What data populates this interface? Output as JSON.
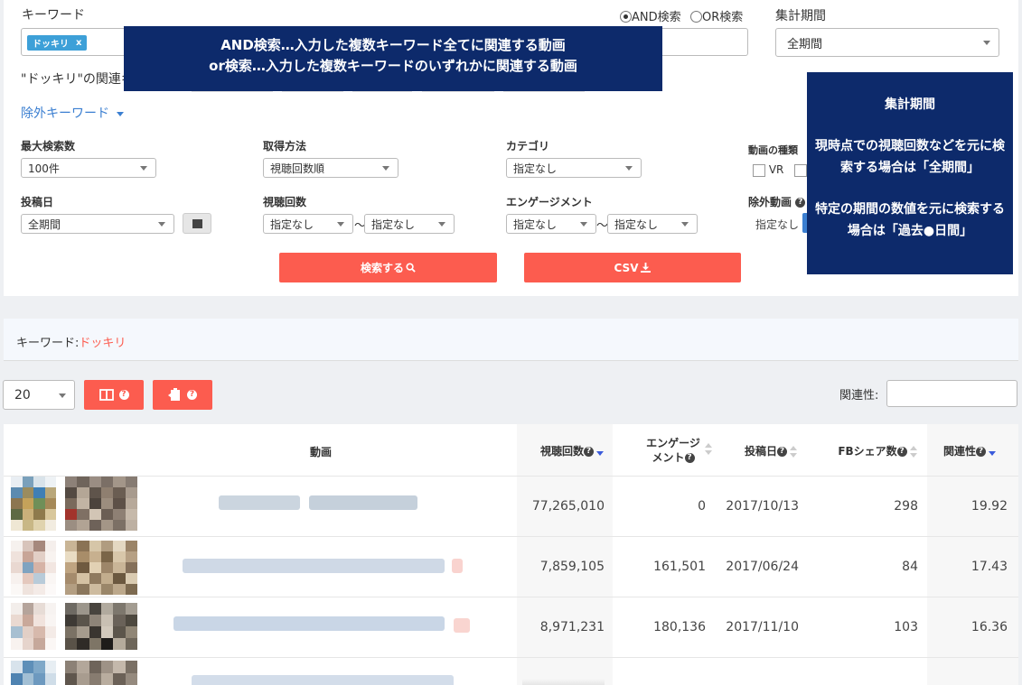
{
  "search": {
    "keyword_label": "キーワード",
    "tag": "ドッキリ",
    "tag_close": "x",
    "radio_and": "AND検索",
    "radio_or": "OR検索",
    "period_label": "集計期間",
    "period_value": "全期間",
    "related_label": "\"ドッキリ\"の関連キ",
    "exclude_toggle": "除外キーワード"
  },
  "tooltips": {
    "andor_line1": "AND検索…入力した複数キーワード全てに関連する動画",
    "andor_line2": "or検索…入力した複数キーワードのいずれかに関連する動画",
    "period_title": "集計期間",
    "period_p1": "現時点での視聴回数などを元に検索する場合は「全期間」",
    "period_p2": "特定の期間の数値を元に検索する場合は「過去●日間」"
  },
  "filters": {
    "max_label": "最大検索数",
    "max_value": "100件",
    "method_label": "取得方法",
    "method_value": "視聴回数順",
    "category_label": "カテゴリ",
    "category_value": "指定なし",
    "type_label": "動画の種類",
    "type_vr": "VR",
    "date_label": "投稿日",
    "date_value": "全期間",
    "views_label": "視聴回数",
    "views_from": "指定なし",
    "views_to": "指定なし",
    "engagement_label": "エンゲージメント",
    "eng_from": "指定なし",
    "eng_to": "指定なし",
    "tilde": "〜",
    "exclude_label": "除外動画",
    "exclude_value": "指定なし"
  },
  "actions": {
    "search_button": "検索する",
    "csv_button": "CSV"
  },
  "result": {
    "keyword_prefix": "キーワード:",
    "keyword_value": "ドッキリ"
  },
  "table_controls": {
    "page_size": "20",
    "relevance_label": "関連性:"
  },
  "table": {
    "headers": {
      "video": "動画",
      "views": "視聴回数",
      "engagement_1": "エンゲージ",
      "engagement_2": "メント",
      "posted": "投稿日",
      "fb_shares": "FBシェア数",
      "relevance": "関連性"
    },
    "rows": [
      {
        "views": "77,265,010",
        "engagement": "0",
        "posted": "2017/10/13",
        "fb": "298",
        "relevance": "19.92"
      },
      {
        "views": "7,859,105",
        "engagement": "161,501",
        "posted": "2017/06/24",
        "fb": "84",
        "relevance": "17.43"
      },
      {
        "views": "8,971,231",
        "engagement": "180,136",
        "posted": "2017/11/10",
        "fb": "103",
        "relevance": "16.36"
      }
    ]
  },
  "colors": {
    "accent_red": "#fc5c4f",
    "tooltip_navy": "#0d2a6b",
    "tag_blue": "#3da0d8",
    "sort_blue": "#3b5bdb"
  }
}
